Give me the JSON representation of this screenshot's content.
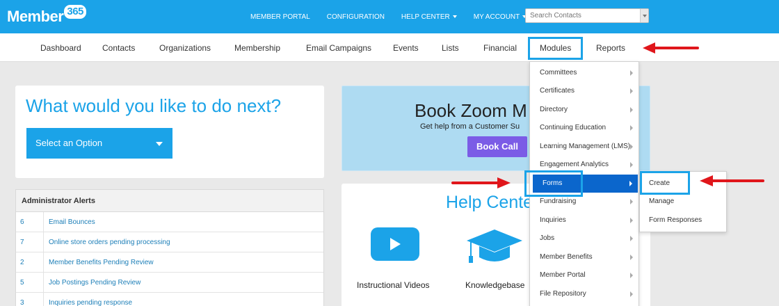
{
  "colors": {
    "brand": "#1ba3e8",
    "highlight": "#1ba3e8",
    "annotation_arrow": "#e0161b",
    "active_item": "#0b66cc",
    "book_button": "#7b5ce6"
  },
  "logo": {
    "text": "Member",
    "badge": "365"
  },
  "topnav": {
    "member_portal": "MEMBER PORTAL",
    "configuration": "CONFIGURATION",
    "help_center": "HELP CENTER",
    "my_account": "MY ACCOUNT",
    "search_placeholder": "Search Contacts"
  },
  "secnav": {
    "dashboard": "Dashboard",
    "contacts": "Contacts",
    "organizations": "Organizations",
    "membership": "Membership",
    "email_campaigns": "Email Campaigns",
    "events": "Events",
    "lists": "Lists",
    "financial": "Financial",
    "modules": "Modules",
    "reports": "Reports"
  },
  "next": {
    "title": "What would you like to do next?",
    "select_label": "Select an Option"
  },
  "alerts": {
    "header": "Administrator Alerts",
    "rows": [
      {
        "count": "6",
        "label": "Email Bounces"
      },
      {
        "count": "7",
        "label": "Online store orders pending processing"
      },
      {
        "count": "2",
        "label": "Member Benefits Pending Review"
      },
      {
        "count": "5",
        "label": "Job Postings Pending Review"
      },
      {
        "count": "3",
        "label": "Inquiries pending response"
      }
    ]
  },
  "zoom": {
    "title": "Book Zoom M",
    "subtitle": "Get help from a Customer Su",
    "button": "Book Call"
  },
  "help": {
    "title": "Help Cente",
    "videos": "Instructional Videos",
    "kb": "Knowledgebase"
  },
  "dropdown": {
    "items": [
      "Committees",
      "Certificates",
      "Directory",
      "Continuing Education",
      "Learning Management (LMS)",
      "Engagement Analytics",
      "Forms",
      "Fundraising",
      "Inquiries",
      "Jobs",
      "Member Benefits",
      "Member Portal",
      "File Repository"
    ],
    "active": "Forms"
  },
  "submenu": {
    "items": [
      "Create",
      "Manage",
      "Form Responses"
    ]
  }
}
